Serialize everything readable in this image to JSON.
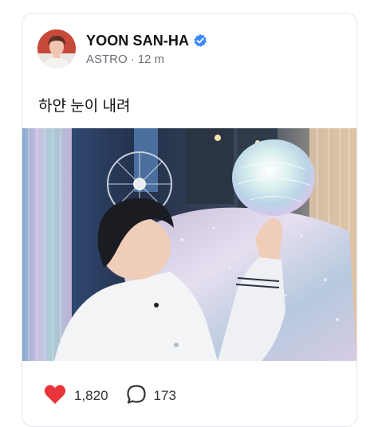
{
  "post": {
    "author_name": "YOON SAN-HA",
    "group": "ASTRO",
    "separator": "·",
    "time_ago": "12 m",
    "text": "하얀 눈이 내려"
  },
  "stats": {
    "likes": "1,820",
    "comments": "173"
  },
  "colors": {
    "like_red": "#e8353c",
    "verified_blue": "#3d8af7",
    "meta_gray": "#6b6f76"
  },
  "icons": {
    "verified": "verified-badge-icon",
    "like": "heart-icon",
    "comment": "comment-bubble-icon"
  }
}
